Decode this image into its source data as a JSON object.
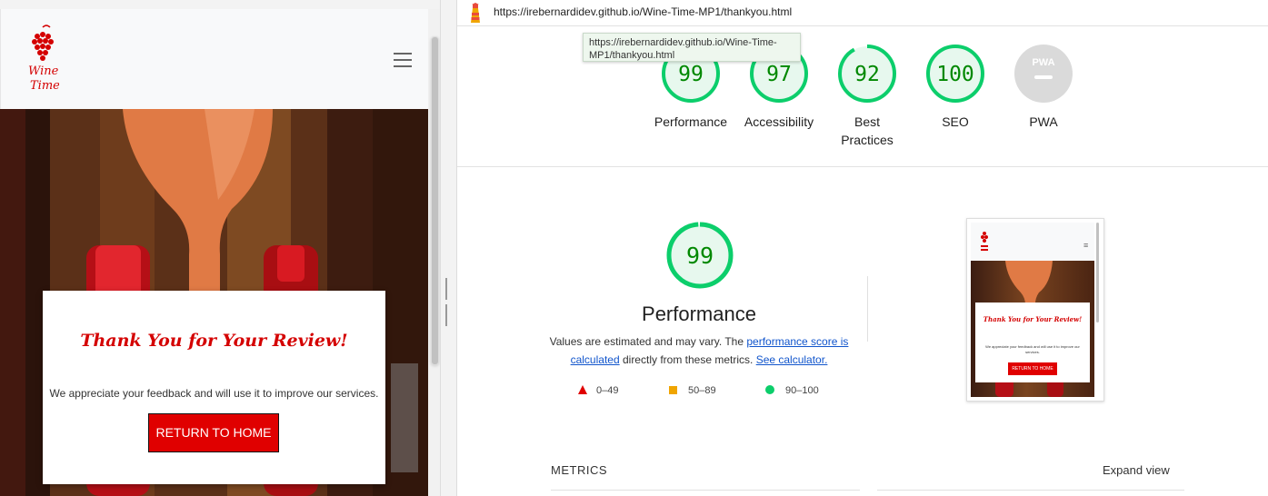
{
  "site": {
    "logo_alt": "Wine Time",
    "card": {
      "title": "Thank You for Your Review!",
      "text": "We appreciate your feedback and will use it to improve our services.",
      "button": "RETURN TO HOME"
    }
  },
  "report": {
    "url": "https://irebernardidev.github.io/Wine-Time-MP1/thankyou.html",
    "tooltip": "https://irebernardidev.github.io/Wine-Time-MP1/thankyou.html",
    "gauges": [
      {
        "score": "99",
        "label": "Performance",
        "value": 0.99
      },
      {
        "score": "97",
        "label": "Accessibility",
        "value": 0.97
      },
      {
        "score": "92",
        "label_line1": "Best",
        "label_line2": "Practices",
        "value": 0.92
      },
      {
        "score": "100",
        "label": "SEO",
        "value": 1.0
      },
      {
        "badge": "PWA",
        "label": "PWA"
      }
    ],
    "performance": {
      "score": "99",
      "title": "Performance",
      "desc_pre": "Values are estimated and may vary. The ",
      "link1": "performance score is calculated",
      "desc_mid": " directly from these metrics. ",
      "link2": "See calculator."
    },
    "legend": [
      {
        "range": "0–49",
        "color": "#e00000"
      },
      {
        "range": "50–89",
        "color": "#f0a500"
      },
      {
        "range": "90–100",
        "color": "#0cce6b"
      }
    ],
    "thumbnail": {
      "title": "Thank You for Your Review!",
      "text": "We appreciate your feedback and will use it to improve our services.",
      "button": "RETURN TO HOME"
    },
    "metrics_title": "METRICS",
    "expand": "Expand view"
  },
  "colors": {
    "pass": "#0cce6b",
    "pass_text": "#008800",
    "brand_red": "#e00000",
    "link": "#1155cc"
  }
}
